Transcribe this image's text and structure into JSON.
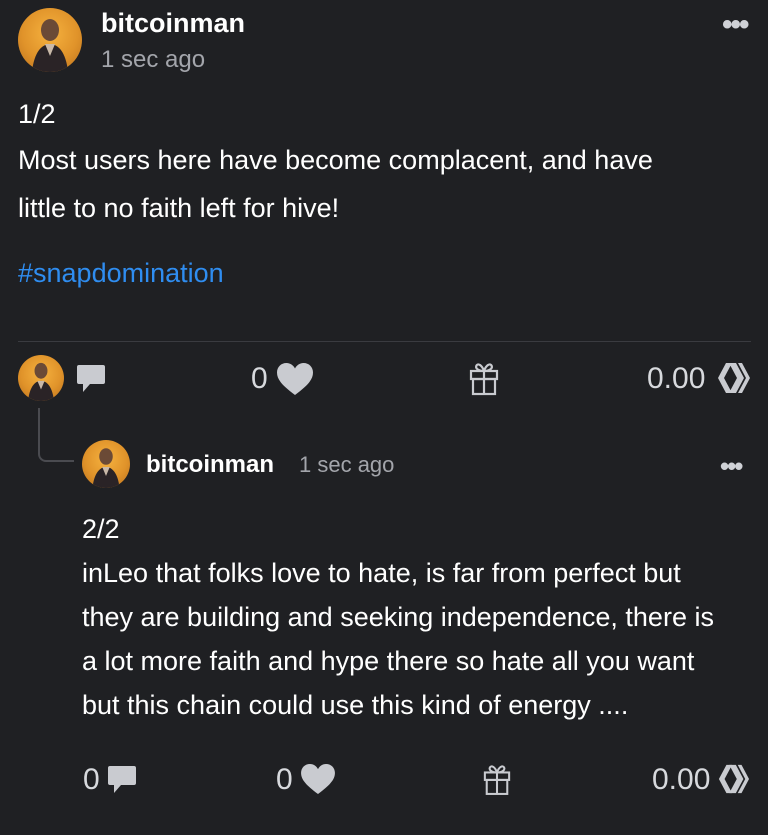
{
  "post": {
    "author": "bitcoinman",
    "time": "1 sec ago",
    "lines": [
      "1/2",
      "Most users here have become complacent, and have",
      "little to no faith left for hive!"
    ],
    "hashtag": "#snapdomination",
    "like_count": "0",
    "payout": "0.00"
  },
  "reply": {
    "author": "bitcoinman",
    "time": "1 sec ago",
    "lines": [
      "2/2",
      "inLeo that folks love to hate, is far from perfect but",
      "they are building and seeking independence, there is",
      "a lot more faith and hype there so hate all you want",
      "but this chain could use this kind of energy ...."
    ],
    "comment_count": "0",
    "like_count": "0",
    "payout": "0.00"
  },
  "menu_glyph": "•••",
  "icons": [
    "more-options-icon",
    "comment-icon",
    "heart-icon",
    "gift-icon",
    "hive-icon",
    "thread-connector"
  ],
  "colors": {
    "background": "#1f2023",
    "text": "#ffffff",
    "muted": "#a3a5ab",
    "link": "#2f8df0",
    "icon": "#c9cbd0"
  }
}
